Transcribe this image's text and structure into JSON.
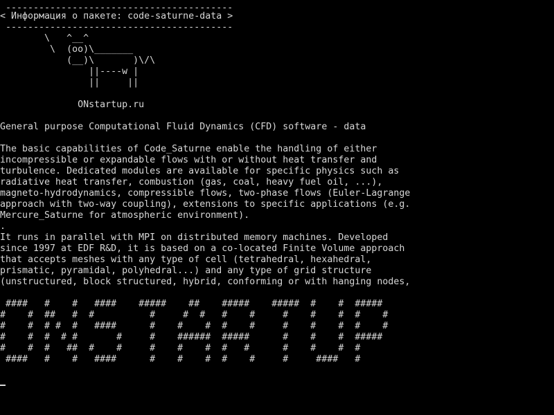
{
  "terminal": {
    "cowsay": {
      "top_border": " -----------------------------------------",
      "message": "< Информация о пакете: code-saturne-data >",
      "bottom_border": " -----------------------------------------",
      "cow": [
        "        \\   ^__^",
        "         \\  (oo)\\_______",
        "            (__)\\       )\\/\\",
        "                ||----w |",
        "                ||     ||"
      ],
      "site": "              ONstartup.ru"
    },
    "summary": "General purpose Computational Fluid Dynamics (CFD) software - data",
    "description_1": [
      "The basic capabilities of Code_Saturne enable the handling of either",
      "incompressible or expandable flows with or without heat transfer and",
      "turbulence. Dedicated modules are available for specific physics such as",
      "radiative heat transfer, combustion (gas, coal, heavy fuel oil, ...),",
      "magneto-hydrodynamics, compressible flows, two-phase flows (Euler-Lagrange",
      "approach with two-way coupling), extensions to specific applications (e.g.",
      "Mercure_Saturne for atmospheric environment)."
    ],
    "separator": ".",
    "description_2": [
      "It runs in parallel with MPI on distributed memory machines. Developed",
      "since 1997 at EDF R&D, it is based on a co-located Finite Volume approach",
      "that accepts meshes with any type of cell (tetrahedral, hexahedral,",
      "prismatic, pyramidal, polyhedral...) and any type of grid structure",
      "(unstructured, block structured, hybrid, conforming or with hanging nodes,"
    ],
    "banner": [
      " ####   #    #   ####    #####    ##    #####    #####  #    #  #####",
      "#    #  ##   #  #          #     #  #   #    #     #    #    #  #    #",
      "#    #  # #  #   ####      #    #    #  #    #     #    #    #  #    #",
      "#    #  #  # #       #     #    ######  #####      #    #    #  #####",
      "#    #  #   ##  #    #     #    #    #  #   #      #    #    #  #",
      " ####   #    #   ####      #    #    #  #    #     #     ####   #"
    ]
  }
}
